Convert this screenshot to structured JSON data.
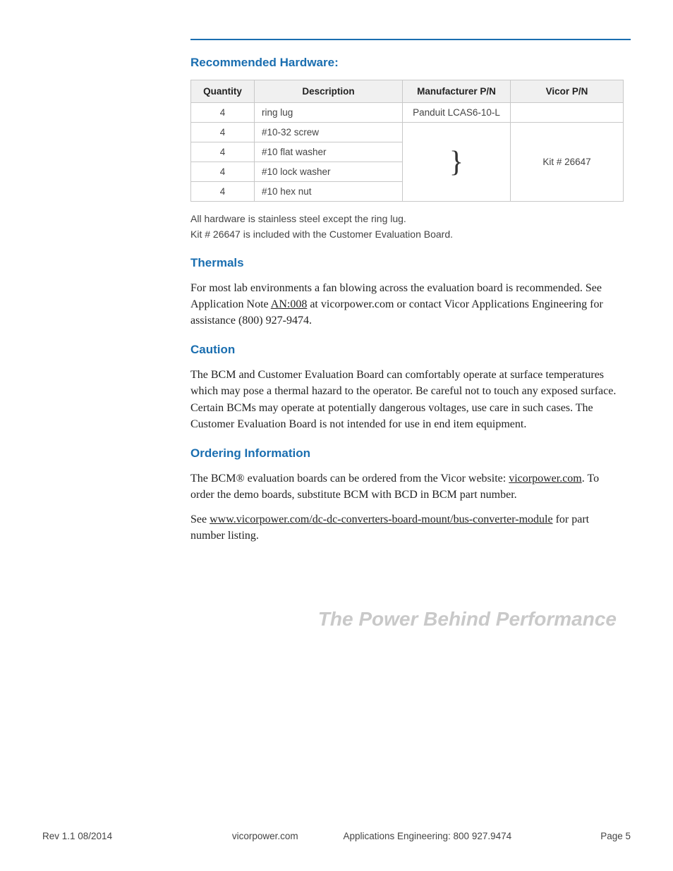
{
  "sections": {
    "hardware": {
      "title": "Recommended Hardware:",
      "headers": {
        "qty": "Quantity",
        "desc": "Description",
        "mfr": "Manufacturer P/N",
        "vicor": "Vicor P/N"
      },
      "rows": [
        {
          "qty": "4",
          "desc": "ring lug",
          "mfr": "Panduit LCAS6-10-L"
        },
        {
          "qty": "4",
          "desc": "#10-32 screw"
        },
        {
          "qty": "4",
          "desc": "#10 flat washer"
        },
        {
          "qty": "4",
          "desc": "#10 lock washer"
        },
        {
          "qty": "4",
          "desc": "#10 hex nut"
        }
      ],
      "brace": "}",
      "vicor_kit": "Kit # 26647",
      "note1": "All hardware is stainless steel except the ring lug.",
      "note2": "Kit # 26647 is included with the Customer Evaluation Board."
    },
    "thermals": {
      "title": "Thermals",
      "p1a": "For most lab environments a fan blowing across the evaluation board is recommended. See Application Note ",
      "link": "AN:008",
      "p1b": " at vicorpower.com or contact Vicor Applications Engineering for assistance (800) 927-9474."
    },
    "caution": {
      "title": "Caution",
      "p1": "The BCM and Customer Evaluation Board can comfortably operate at surface temperatures which may pose a thermal hazard to the operator. Be careful not to touch any exposed surface. Certain BCMs may operate at potentially dangerous voltages, use care in such cases. The Customer Evaluation Board is not intended for use in end item equipment."
    },
    "ordering": {
      "title": "Ordering Information",
      "p1a": "The BCM® evaluation boards can be ordered from the Vicor website: ",
      "link1": "vicorpower.com",
      "p1b": ". To order the demo boards, substitute BCM with BCD in BCM part number.",
      "p2a": "See ",
      "link2": "www.vicorpower.com/dc-dc-converters-board-mount/bus-converter-module",
      "p2b": " for part number listing."
    }
  },
  "tagline": "The Power Behind Performance",
  "footer": {
    "rev": "Rev 1.1   08/2014",
    "site": "vicorpower.com",
    "eng": "Applications Engineering: 800 927.9474",
    "page": "Page 5"
  }
}
